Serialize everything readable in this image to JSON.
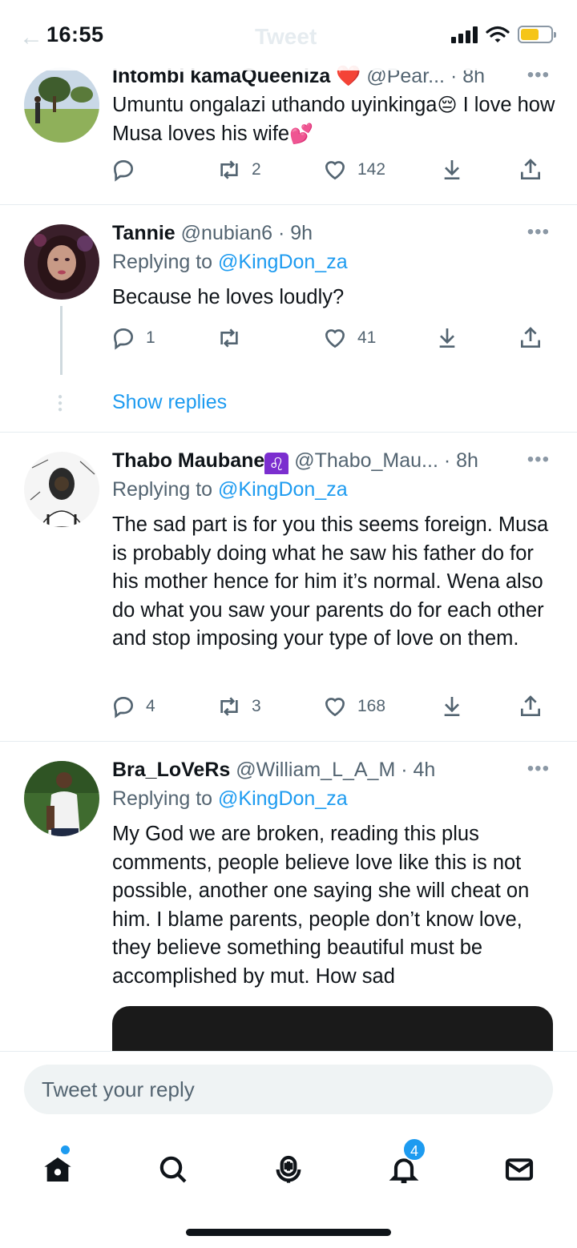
{
  "status_bar": {
    "time": "16:55",
    "ghost_title": "Tweet",
    "battery_level": 0.6
  },
  "tweets": [
    {
      "name": "Intombi kamaQueeniza",
      "name_emoji": "❤️",
      "handle": "@Pear...",
      "time": "· 8h",
      "text": "Umuntu ongalazi uthando uyinkinga",
      "text_emoji": "😔",
      "text_after": " I love how Musa loves his wife",
      "text_end_emoji": "💕",
      "replies": "",
      "retweets": "2",
      "likes": "142"
    },
    {
      "name": "Tannie",
      "handle": "@nubian6",
      "time": "· 9h",
      "replying_prefix": "Replying to",
      "replying_to": "@KingDon_za",
      "text": "Because he loves loudly?",
      "replies": "1",
      "retweets": "",
      "likes": "41",
      "show_replies": "Show replies"
    },
    {
      "name": "Thabo Maubane",
      "name_emoji": "♌",
      "handle": "@Thabo_Mau...",
      "time": "· 8h",
      "replying_prefix": "Replying to",
      "replying_to": "@KingDon_za",
      "text": "The sad part is for you this seems foreign. Musa is probably doing what he saw his father do for his mother hence for him it’s normal. Wena also do what you saw your parents do for each other and stop imposing your type of love on them.",
      "replies": "4",
      "retweets": "3",
      "likes": "168"
    },
    {
      "name": "Bra_LoVeRs",
      "handle": "@William_L_A_M",
      "time": "· 4h",
      "replying_prefix": "Replying to",
      "replying_to": "@KingDon_za",
      "text": "My God we are broken, reading this plus comments, people believe love like this is not possible, another one saying she will cheat on him. I blame parents, people don’t know love, they believe something beautiful must be accomplished by mut. How sad"
    }
  ],
  "reply_bar": {
    "placeholder": "Tweet your reply"
  },
  "tab_bar": {
    "items": [
      "home",
      "search",
      "spaces",
      "notifications",
      "messages"
    ],
    "notifications_count": "4"
  },
  "icons": {
    "reply": "reply-icon",
    "retweet": "retweet-icon",
    "like": "heart-icon",
    "bookmark": "bookmark-download-icon",
    "share": "share-icon"
  },
  "colors": {
    "accent": "#1d9bf0",
    "text": "#0f1419",
    "secondary": "#536471",
    "divider": "#e6ecf0"
  }
}
